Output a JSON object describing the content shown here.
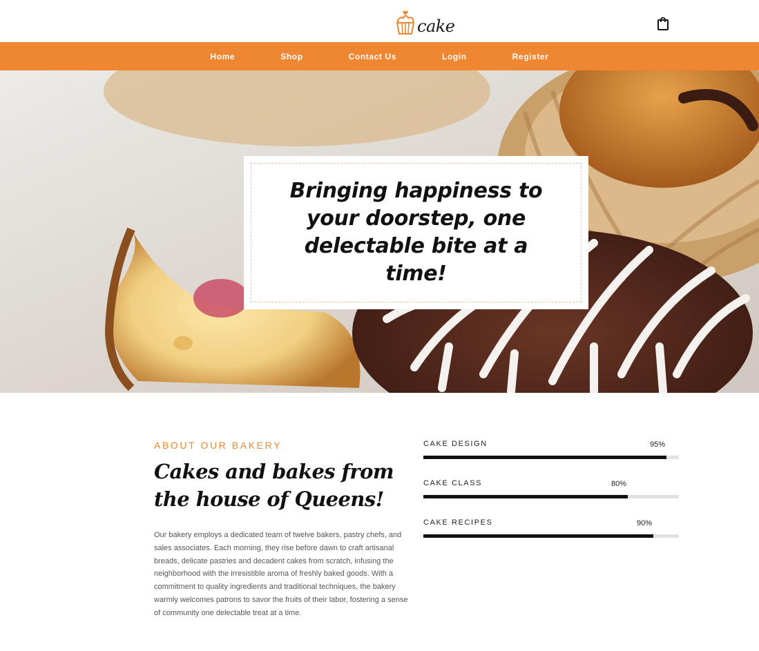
{
  "header": {
    "brand": "cake",
    "cart_icon": "shopping-bag-icon",
    "logo_icon": "cupcake-icon"
  },
  "nav": {
    "items": [
      {
        "label": "Home"
      },
      {
        "label": "Shop"
      },
      {
        "label": "Contact Us"
      },
      {
        "label": "Login"
      },
      {
        "label": "Register"
      }
    ]
  },
  "hero": {
    "headline": "Bringing happiness to your doorstep, one delectable bite at a time!"
  },
  "about": {
    "eyebrow": "ABOUT OUR BAKERY",
    "heading": "Cakes and bakes from the house of Queens!",
    "body": "Our bakery employs a dedicated team of twelve bakers, pastry chefs, and sales associates. Each morning, they rise before dawn to craft artisanal breads, delicate pastries and decadent cakes from scratch, infusing the neighborhood with the irresistible aroma of freshly baked goods. With a commitment to quality ingredients and traditional techniques, the bakery warmly welcomes patrons to savor the fruits of their labor, fostering a sense of community one delectable treat at a time."
  },
  "skills": [
    {
      "label": "CAKE DESIGN",
      "percent_text": "95%",
      "value": 95
    },
    {
      "label": "CAKE CLASS",
      "percent_text": "80%",
      "value": 80
    },
    {
      "label": "CAKE RECIPES",
      "percent_text": "90%",
      "value": 90
    }
  ],
  "colors": {
    "accent": "#ef8631",
    "bar_fill": "#111111",
    "bar_track": "#e2e2e2"
  }
}
